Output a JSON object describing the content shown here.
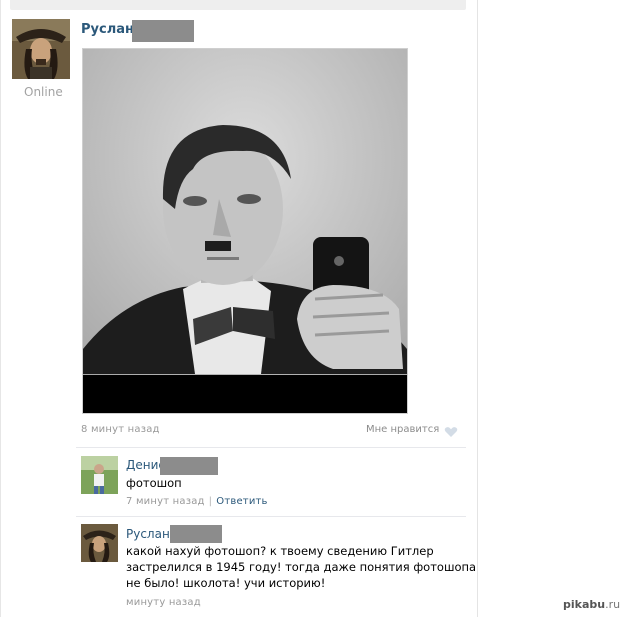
{
  "post": {
    "author": "Руслан",
    "status": "Online",
    "time": "8 минут назад",
    "like_label": "Мне нравится"
  },
  "comments": [
    {
      "author": "Денис",
      "text": "фотошоп",
      "time": "7 минут назад",
      "reply_label": "Ответить"
    },
    {
      "author": "Руслан",
      "text_lines": [
        "какой нахуй фотошоп? к твоему сведению Гитлер",
        "застрелился в 1945 году! тогда даже понятия фотошопа",
        "не было! школота! учи историю!"
      ],
      "time": "минуту назад"
    }
  ],
  "watermark": {
    "brand": "pikabu",
    "tld": ".ru"
  },
  "icons": [
    "heart-icon"
  ],
  "colors": {
    "link": "#2b587a",
    "meta": "#999999",
    "redaction": "#8c8c8c"
  }
}
